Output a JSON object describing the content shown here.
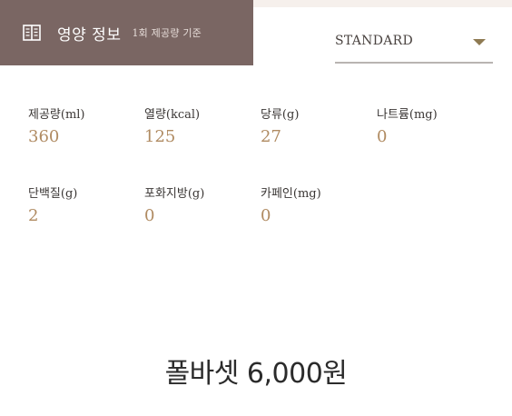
{
  "header": {
    "icon": "book-icon",
    "title": "영양 정보",
    "subtitle": "1회 제공량 기준"
  },
  "size_select": {
    "value": "STANDARD",
    "icon": "caret-down-icon"
  },
  "nutrition": [
    {
      "label": "제공량(ml)",
      "value": "360"
    },
    {
      "label": "열량(kcal)",
      "value": "125"
    },
    {
      "label": "당류(g)",
      "value": "27"
    },
    {
      "label": "나트륨(mg)",
      "value": "0"
    },
    {
      "label": "단백질(g)",
      "value": "2"
    },
    {
      "label": "포화지방(g)",
      "value": "0"
    },
    {
      "label": "카페인(mg)",
      "value": "0"
    }
  ],
  "price_text": "폴바셋 6,000원",
  "colors": {
    "header_bg": "#7a6663",
    "accent_value": "#b08b62",
    "caret": "#8e7a52"
  }
}
